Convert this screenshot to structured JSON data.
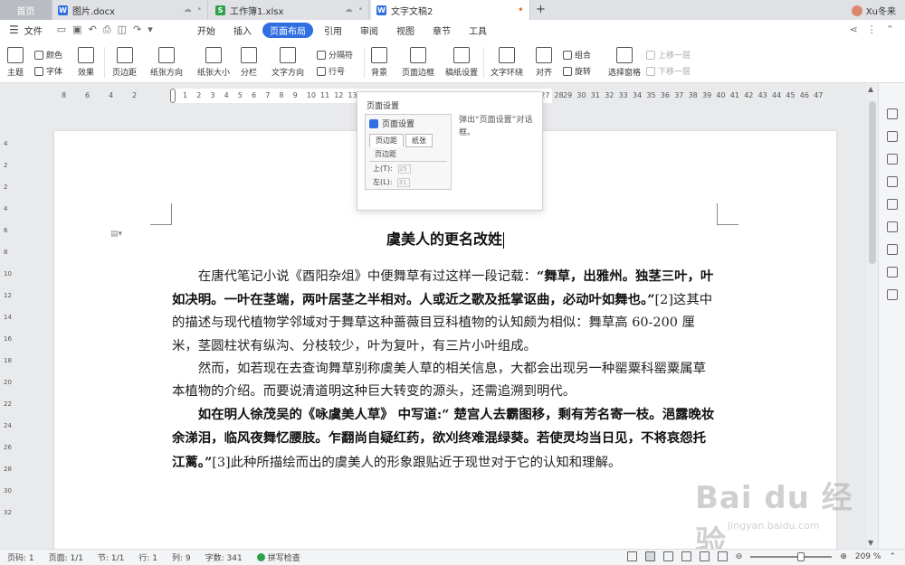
{
  "tabs": [
    {
      "label": "首页"
    },
    {
      "label": "图片.docx",
      "icon": "W"
    },
    {
      "label": "工作簿1.xlsx",
      "icon": "S"
    },
    {
      "label": "文字文稿2",
      "icon": "W"
    }
  ],
  "user": {
    "name": "Xu冬来"
  },
  "menu": {
    "file": "文件",
    "items": [
      "开始",
      "插入",
      "页面布局",
      "引用",
      "审阅",
      "视图",
      "章节",
      "工具"
    ],
    "active": "页面布局"
  },
  "ribbon": {
    "theme": "主题",
    "color": "颜色",
    "font": "字体",
    "effect": "效果",
    "margin": "页边距",
    "orientation": "纸张方向",
    "size": "纸张大小",
    "columns": "分栏",
    "text_direction": "文字方向",
    "separator": "分隔符",
    "line_no": "行号",
    "background": "背景",
    "page_border": "页面边框",
    "manuscript": "稿纸设置",
    "text_wrap": "文字环绕",
    "align": "对齐",
    "group": "组合",
    "rotate": "旋转",
    "select_pane": "选择窗格",
    "bring_forward": "上移一层",
    "send_backward": "下移一层"
  },
  "ruler": {
    "h_left": [
      "8",
      "6",
      "4",
      "2"
    ],
    "h_nums": [
      "1",
      "2",
      "4",
      "6",
      "8",
      "10",
      "12",
      "14",
      "16",
      "18",
      "20",
      "22",
      "24",
      "26",
      "28",
      "30",
      "32",
      "34",
      "36",
      "38",
      "40",
      "42",
      "44",
      "46",
      "48"
    ],
    "h_right": [
      "29",
      "30",
      "31",
      "32",
      "33",
      "34",
      "35",
      "36",
      "37",
      "38",
      "39",
      "40",
      "41",
      "42",
      "43",
      "44",
      "45",
      "46",
      "47"
    ],
    "v_nums": [
      "4",
      "2",
      "2",
      "4",
      "6",
      "8",
      "10",
      "12",
      "14",
      "16",
      "18",
      "20",
      "22",
      "24",
      "26",
      "28",
      "30",
      "32"
    ]
  },
  "popup": {
    "heading": "页面设置",
    "description": "弹出“页面设置”对话框。",
    "preview_title": "页面设置",
    "preview_tab1": "页边距",
    "preview_tab2": "纸张",
    "preview_section": "页边距",
    "preview_top": "上(T):",
    "preview_top_val": "25",
    "preview_left": "左(L):",
    "preview_left_val": "31"
  },
  "document": {
    "title": "虞美人的更名改姓",
    "p1_a": "在唐代笔记小说《酉阳杂俎》中便舞草有过这样一段记载：",
    "p1_b": "“舞草，出雅州。独茎三叶，叶如决明。一叶在茎端，两叶居茎之半相对。人或近之歌及抵掌讴曲，必动叶如舞也。”",
    "p1_c": "[2]这其中的描述与现代植物学邻域对于舞草这种蔷薇目豆科植物的认知颇为相似：舞草高 60-200 厘米，茎圆柱状有纵沟、分枝较少，叶为复叶，有三片小叶组成。",
    "p2": "然而，如若现在去查询舞草别称虞美人草的相关信息，大都会出现另一种罂粟科罂粟属草本植物的介绍。而要说清道明这种巨大转变的源头，还需追溯到明代。",
    "p3_a": "如在明人徐茂吴的《咏虞美人草》 中写道:“ 楚宫人去霸图移，剩有芳名寄一枝。浥露晚妆余涕泪，临风夜舞忆腰肢。乍翻尚自疑红药，欲刈终难混绿葵。若使灵均当日见，不将哀怨托江蓠。”",
    "p3_b": "[3]此种所描绘而出的虞美人的形象跟贴近于现世对于它的认知和理解。"
  },
  "status": {
    "page_no": "页码: 1",
    "pages": "页面: 1/1",
    "section": "节: 1/1",
    "row": "行: 1",
    "col": "列: 9",
    "words": "字数: 341",
    "spell": "拼写检查",
    "zoom": "209 %",
    "zoom_level": 0.62
  },
  "watermark": {
    "big": "Bai du 经验",
    "small": "jingyan.baidu.com"
  }
}
